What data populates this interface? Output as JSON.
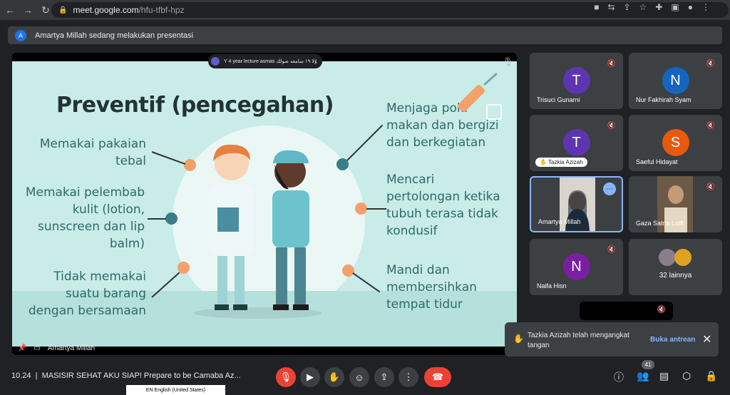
{
  "browser": {
    "url_host": "meet.google.com",
    "url_path": "/hfu-tfbf-hpz"
  },
  "banner": {
    "text": "Amartya Millah sedang melakukan presentasi"
  },
  "slide": {
    "lecture_pill": "Y 4 year lecture  asmas  وُلا ١٩ سامعه صولك",
    "title": "Preventif (pencegahan)",
    "left_items": [
      "Memakai pakaian tebal",
      "Memakai pelembab kulit (lotion, sunscreen dan lip balm)",
      "Tidak memakai suatu barang dengan bersamaan"
    ],
    "right_items": [
      "Menjaga pola makan dan bergizi dan berkegiatan",
      "Mencari pertolongan ketika tubuh terasa tidak kondusif",
      "Mandi dan membersihkan tempat tidur"
    ],
    "colors": {
      "bg": "#c9ece8",
      "dot_orange": "#f4a06b",
      "dot_teal": "#3a7d8a",
      "text": "#2d6a69"
    }
  },
  "stage_footer": {
    "presenter": "Amartya Millah"
  },
  "participants": [
    {
      "name": "Trisuci Gunarni",
      "initial": "T",
      "color": "#5e35b1"
    },
    {
      "name": "Nur Fakhirah Syam",
      "initial": "N",
      "color": "#1565c0"
    },
    {
      "name": "Tazkia Azizah",
      "initial": "T",
      "color": "#5e35b1"
    },
    {
      "name": "Saeful Hidayat",
      "initial": "S",
      "color": "#e8590c"
    },
    {
      "name": "Amartya Millah",
      "initial": "",
      "color": "#3c4043"
    },
    {
      "name": "Gaza Satria Lutfi",
      "initial": "",
      "color": "#3c4043"
    },
    {
      "name": "Naifa Hisn",
      "initial": "N",
      "color": "#7b1fa2"
    },
    {
      "name": "32 lainnya",
      "initial": "",
      "color": "#3c4043"
    }
  ],
  "toast": {
    "text": "Tazkia Azizah telah mengangkat tangan",
    "link": "Buka antrean"
  },
  "bottombar": {
    "time": "10.24",
    "separator": "|",
    "meeting_title": "MASISIR SEHAT AKU SIAP! Prepare to be Camaba Az...",
    "participants_count": "41",
    "language": "EN English (United States)"
  }
}
